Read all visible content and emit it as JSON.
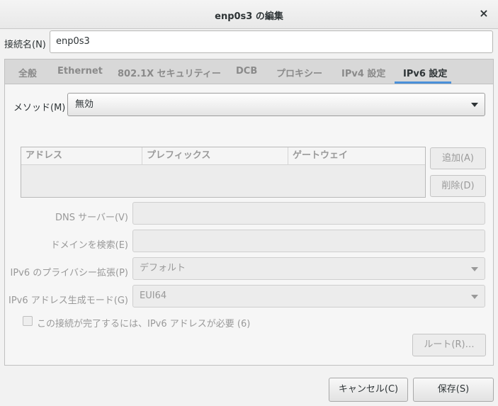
{
  "window": {
    "title": "enp0s3 の編集",
    "close_symbol": "×"
  },
  "connection": {
    "label": "接続名(N)",
    "value": "enp0s3"
  },
  "tabs": [
    {
      "label": "全般",
      "active": false
    },
    {
      "label": "Ethernet",
      "active": false
    },
    {
      "label": "802.1X セキュリティー",
      "active": false
    },
    {
      "label": "DCB",
      "active": false
    },
    {
      "label": "プロキシー",
      "active": false
    },
    {
      "label": "IPv4 設定",
      "active": false
    },
    {
      "label": "IPv6 設定",
      "active": true
    }
  ],
  "method": {
    "label": "メソッド(M)",
    "value": "無効"
  },
  "address_table": {
    "columns": [
      "アドレス",
      "プレフィックス",
      "ゲートウェイ"
    ]
  },
  "buttons": {
    "add": "追加(A)",
    "delete": "削除(D)",
    "routes": "ルート(R)…",
    "cancel": "キャンセル(C)",
    "save": "保存(S)"
  },
  "fields": {
    "dns": {
      "label": "DNS サーバー(V)",
      "value": ""
    },
    "search_domain": {
      "label": "ドメインを検索(E)",
      "value": ""
    },
    "privacy": {
      "label": "IPv6 のプライバシー拡張(P)",
      "value": "デフォルト"
    },
    "addr_gen": {
      "label": "IPv6 アドレス生成モード(G)",
      "value": "EUI64"
    }
  },
  "require_ipv6": {
    "label": "この接続が完了するには、IPv6 アドレスが必要 (6)",
    "checked": false
  },
  "colors": {
    "accent": "#4a90d9",
    "tab_bar": "#d8d8d8",
    "disabled_text": "#999999"
  }
}
